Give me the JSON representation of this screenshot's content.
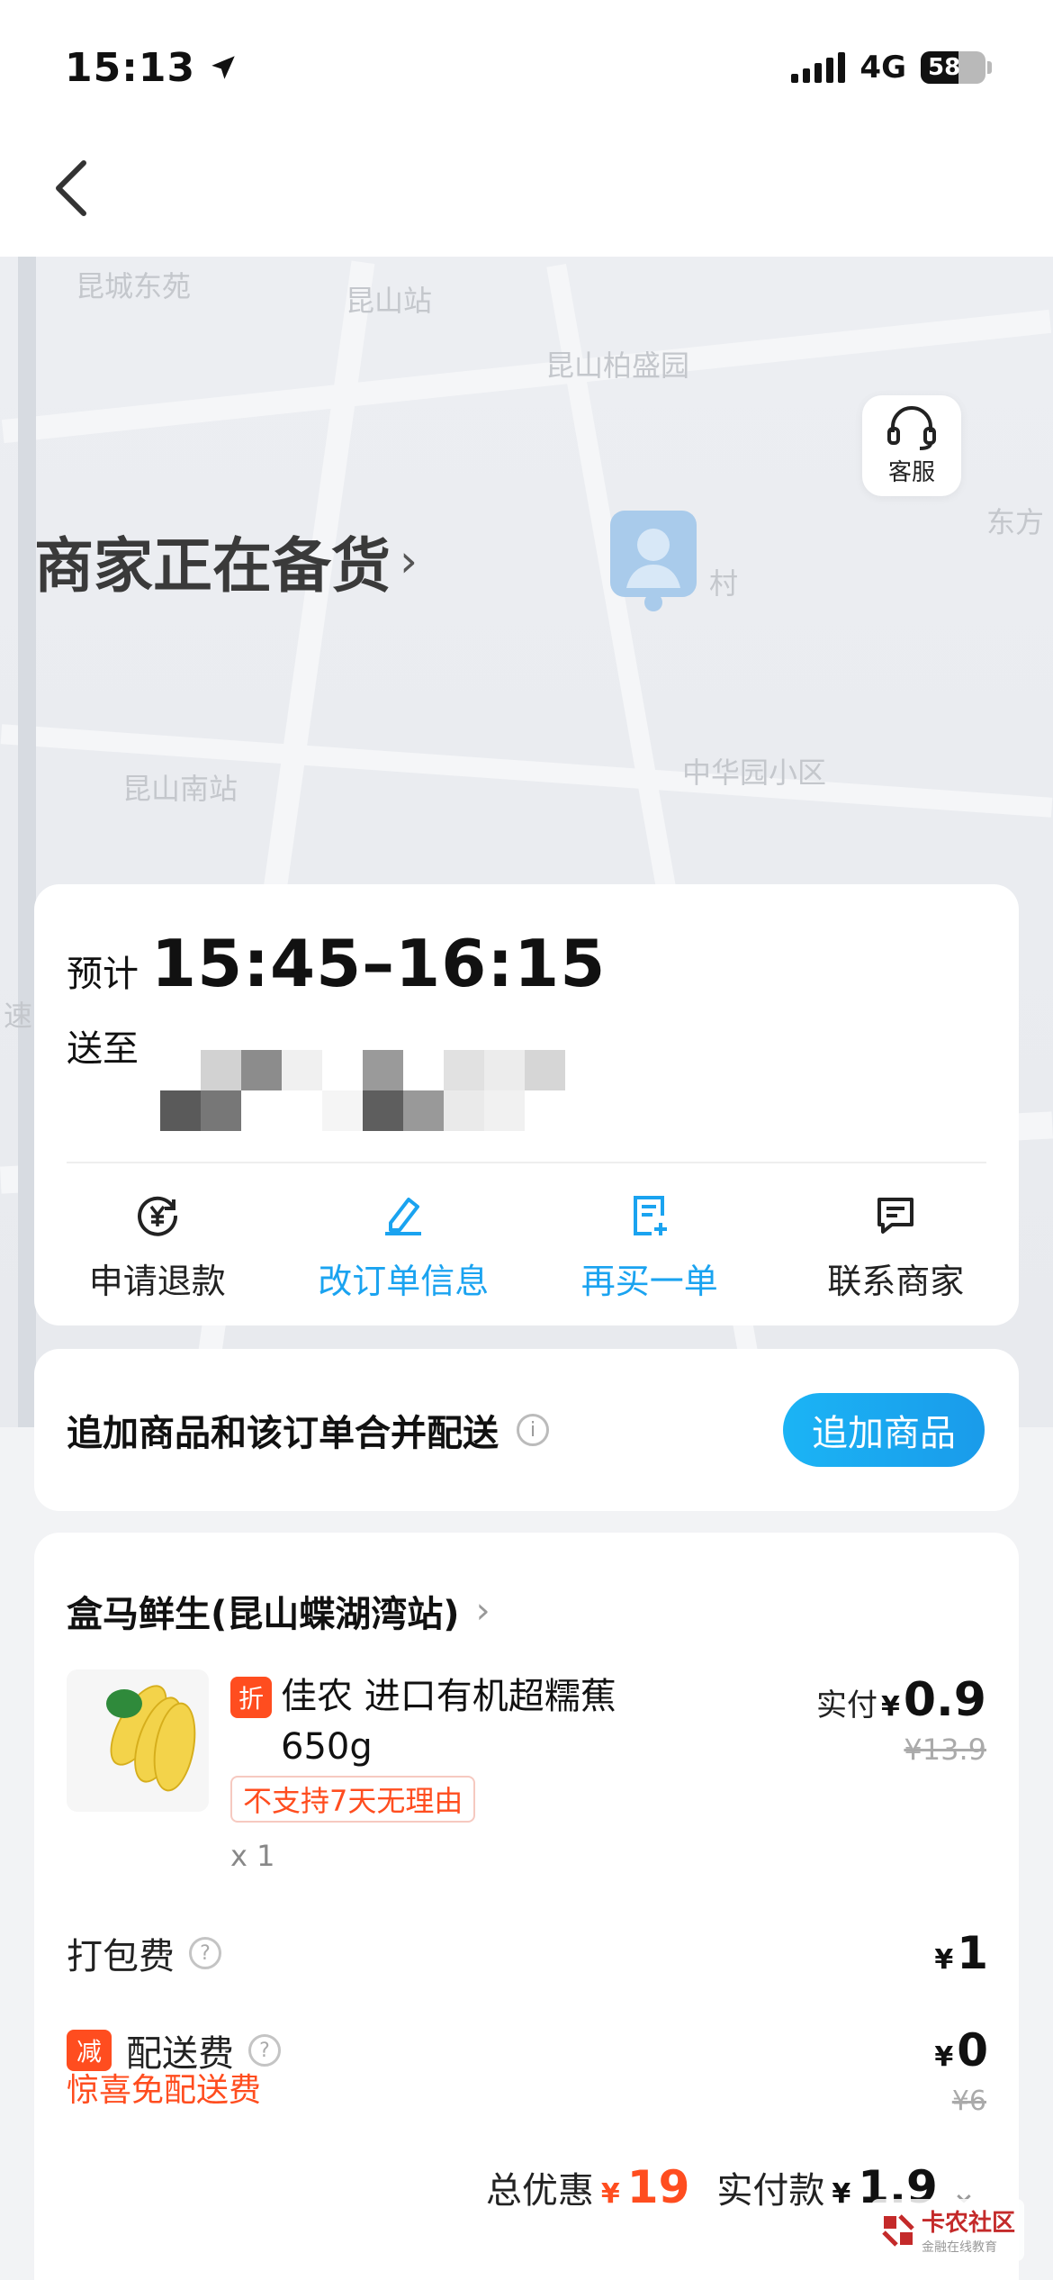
{
  "status_bar": {
    "time": "15:13",
    "network": "4G",
    "battery": "58"
  },
  "map": {
    "labels": [
      "昆城东苑",
      "昆山站",
      "昆山柏盛园",
      "昆山南站",
      "中华园小区",
      "东方",
      "村",
      "速"
    ]
  },
  "customer_service": {
    "label": "客服"
  },
  "order_status": {
    "title": "商家正在备货"
  },
  "delivery_card": {
    "eta_label": "预计",
    "eta_value": "15:45–16:15",
    "address_label": "送至",
    "actions": [
      {
        "label": "申请退款",
        "icon": "refund-icon"
      },
      {
        "label": "改订单信息",
        "icon": "edit-icon"
      },
      {
        "label": "再买一单",
        "icon": "reorder-icon"
      },
      {
        "label": "联系商家",
        "icon": "chat-icon"
      }
    ]
  },
  "add_items": {
    "text": "追加商品和该订单合并配送",
    "button": "追加商品"
  },
  "order": {
    "store": "盒马鲜生(昆山蝶湖湾站)",
    "product": {
      "tag": "折",
      "name": "佳农 进口有机超糯蕉 650g",
      "badge": "不支持7天无理由",
      "qty": "x 1",
      "price_label": "实付",
      "currency": "¥",
      "price": "0.9",
      "original_price": "¥13.9"
    },
    "packing_fee": {
      "label": "打包费",
      "currency": "¥",
      "value": "1"
    },
    "delivery_fee": {
      "tag": "减",
      "label": "配送费",
      "currency": "¥",
      "value": "0",
      "original": "¥6",
      "note": "惊喜免配送费"
    },
    "summary": {
      "discount_label": "总优惠",
      "discount_currency": "¥",
      "discount_value": "19",
      "paid_label": "实付款",
      "paid_currency": "¥",
      "paid_value": "1.9"
    }
  },
  "watermark": {
    "title": "卡农社区",
    "subtitle": "金融在线教育"
  },
  "colors": {
    "accent_blue": "#1aa3f0",
    "accent_red": "#ff4d1f"
  }
}
